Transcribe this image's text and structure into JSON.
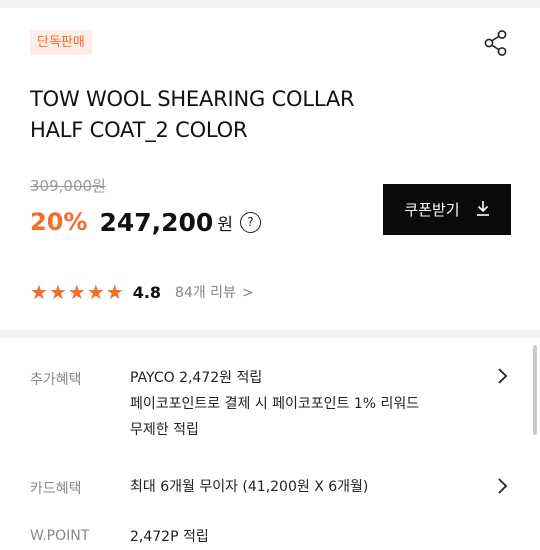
{
  "badge": "단독판매",
  "icons": {
    "share": "share-icon",
    "help": "question-circle-icon",
    "download": "download-icon",
    "star": "star-icon",
    "chevron": "chevron-right-icon"
  },
  "title": {
    "line1": "TOW WOOL SHEARING COLLAR",
    "line2": "HALF COAT_2 COLOR"
  },
  "price": {
    "original": "309,000원",
    "discount": "20%",
    "sale": "247,200",
    "unit": "원",
    "help": "?"
  },
  "coupon": {
    "label": "쿠폰받기",
    "download": "↓"
  },
  "rating": {
    "stars": 5,
    "score": "4.8",
    "reviews": "84개 리뷰",
    "reviews_chevron": ">"
  },
  "benefits": [
    {
      "label": "추가혜택",
      "lines": [
        "PAYCO 2,472원 적립",
        "페이코포인트로 결제 시 페이코포인트 1% 리워드",
        "무제한 적립"
      ]
    },
    {
      "label": "카드혜택",
      "lines": [
        "최대 6개월 무이자 (41,200원 X 6개월)"
      ]
    },
    {
      "label": "W.POINT",
      "lines": [
        "2,472P 적립"
      ]
    }
  ],
  "colors": {
    "accent": "#f36c2c",
    "badge_bg": "#fdeee7",
    "button_bg": "#0a0a0a"
  }
}
